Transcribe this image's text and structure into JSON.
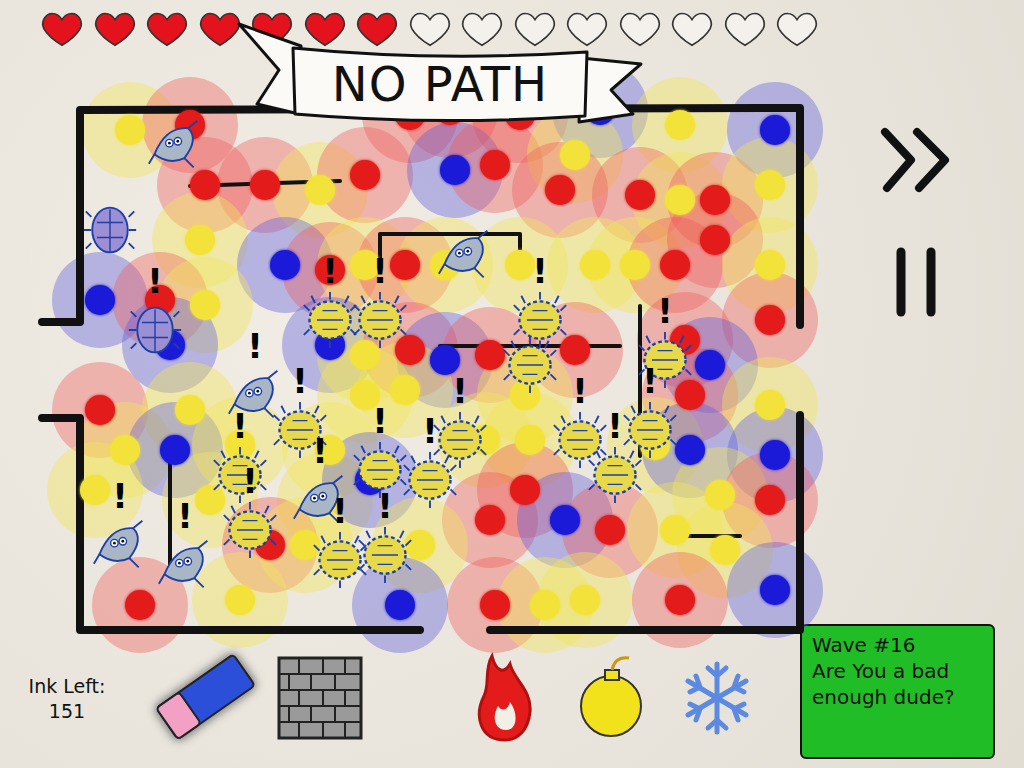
{
  "lives": [
    {
      "filled": true
    },
    {
      "filled": true
    },
    {
      "filled": true
    },
    {
      "filled": true
    },
    {
      "filled": true
    },
    {
      "filled": true
    },
    {
      "filled": true
    },
    {
      "filled": false
    },
    {
      "filled": false
    },
    {
      "filled": false
    },
    {
      "filled": false
    },
    {
      "filled": false
    },
    {
      "filled": false
    },
    {
      "filled": false
    },
    {
      "filled": false
    }
  ],
  "banner": {
    "text": "NO PATH"
  },
  "alert_mark": "!",
  "ink": {
    "label": "Ink Left:",
    "value": "151"
  },
  "tools": [
    {
      "kind": "eraser",
      "selected": true
    },
    {
      "kind": "wall",
      "selected": false
    },
    {
      "kind": "fire",
      "selected": false
    },
    {
      "kind": "bomb",
      "selected": false
    },
    {
      "kind": "freeze",
      "selected": false
    }
  ],
  "wave": {
    "title": "Wave #16",
    "message": "Are You a bad enough dude?"
  },
  "towers": [
    {
      "kind": "bomb"
    },
    {
      "kind": "fire"
    },
    {
      "kind": "fire"
    },
    {
      "kind": "fire"
    },
    {
      "kind": "fire"
    },
    {
      "kind": "freeze"
    },
    {
      "kind": "bomb"
    },
    {
      "kind": "freeze"
    },
    {
      "kind": "fire"
    },
    {
      "kind": "fire"
    },
    {
      "kind": "bomb"
    },
    {
      "kind": "fire"
    },
    {
      "kind": "freeze"
    },
    {
      "kind": "fire"
    },
    {
      "kind": "bomb"
    },
    {
      "kind": "fire"
    },
    {
      "kind": "fire"
    },
    {
      "kind": "bomb"
    },
    {
      "kind": "fire"
    },
    {
      "kind": "bomb"
    },
    {
      "kind": "bomb"
    },
    {
      "kind": "freeze"
    },
    {
      "kind": "fire"
    },
    {
      "kind": "bomb"
    },
    {
      "kind": "fire"
    },
    {
      "kind": "bomb"
    },
    {
      "kind": "bomb"
    },
    {
      "kind": "bomb"
    },
    {
      "kind": "bomb"
    },
    {
      "kind": "fire"
    },
    {
      "kind": "fire"
    },
    {
      "kind": "bomb"
    },
    {
      "kind": "freeze"
    },
    {
      "kind": "fire"
    },
    {
      "kind": "bomb"
    },
    {
      "kind": "fire"
    },
    {
      "kind": "freeze"
    },
    {
      "kind": "freeze"
    },
    {
      "kind": "bomb"
    },
    {
      "kind": "fire"
    },
    {
      "kind": "freeze"
    },
    {
      "kind": "fire"
    },
    {
      "kind": "fire"
    },
    {
      "kind": "fire"
    },
    {
      "kind": "freeze"
    },
    {
      "kind": "fire"
    },
    {
      "kind": "bomb"
    },
    {
      "kind": "bomb"
    },
    {
      "kind": "bomb"
    },
    {
      "kind": "bomb"
    },
    {
      "kind": "fire"
    },
    {
      "kind": "bomb"
    },
    {
      "kind": "bomb"
    },
    {
      "kind": "freeze"
    },
    {
      "kind": "bomb"
    },
    {
      "kind": "bomb"
    },
    {
      "kind": "bomb"
    },
    {
      "kind": "bomb"
    },
    {
      "kind": "bomb"
    },
    {
      "kind": "freeze"
    },
    {
      "kind": "freeze"
    },
    {
      "kind": "bomb"
    },
    {
      "kind": "bomb"
    },
    {
      "kind": "bomb"
    },
    {
      "kind": "freeze"
    },
    {
      "kind": "fire"
    },
    {
      "kind": "fire"
    },
    {
      "kind": "freeze"
    },
    {
      "kind": "fire"
    },
    {
      "kind": "bomb"
    },
    {
      "kind": "bomb"
    },
    {
      "kind": "fire"
    },
    {
      "kind": "fire"
    },
    {
      "kind": "bomb"
    },
    {
      "kind": "bomb"
    },
    {
      "kind": "bomb"
    },
    {
      "kind": "fire"
    },
    {
      "kind": "bomb"
    },
    {
      "kind": "freeze"
    },
    {
      "kind": "fire"
    },
    {
      "kind": "bomb"
    },
    {
      "kind": "bomb"
    },
    {
      "kind": "fire"
    },
    {
      "kind": "freeze"
    }
  ],
  "enemies": [
    {
      "kind": "flyer",
      "alerted": false
    },
    {
      "kind": "beetle",
      "alerted": false
    },
    {
      "kind": "beetle",
      "alerted": true
    },
    {
      "kind": "flyer",
      "alerted": false
    },
    {
      "kind": "crawler",
      "alerted": true
    },
    {
      "kind": "crawler",
      "alerted": true
    },
    {
      "kind": "crawler",
      "alerted": true
    },
    {
      "kind": "crawler",
      "alerted": false
    },
    {
      "kind": "flyer",
      "alerted": true
    },
    {
      "kind": "crawler",
      "alerted": true
    },
    {
      "kind": "crawler",
      "alerted": true
    },
    {
      "kind": "flyer",
      "alerted": true
    },
    {
      "kind": "crawler",
      "alerted": true
    },
    {
      "kind": "crawler",
      "alerted": true
    },
    {
      "kind": "crawler",
      "alerted": true
    },
    {
      "kind": "crawler",
      "alerted": true
    },
    {
      "kind": "crawler",
      "alerted": true
    },
    {
      "kind": "crawler",
      "alerted": true
    },
    {
      "kind": "crawler",
      "alerted": true
    },
    {
      "kind": "flyer",
      "alerted": true
    },
    {
      "kind": "flyer",
      "alerted": true
    },
    {
      "kind": "crawler",
      "alerted": true
    },
    {
      "kind": "crawler",
      "alerted": true
    },
    {
      "kind": "crawler",
      "alerted": true
    }
  ]
}
